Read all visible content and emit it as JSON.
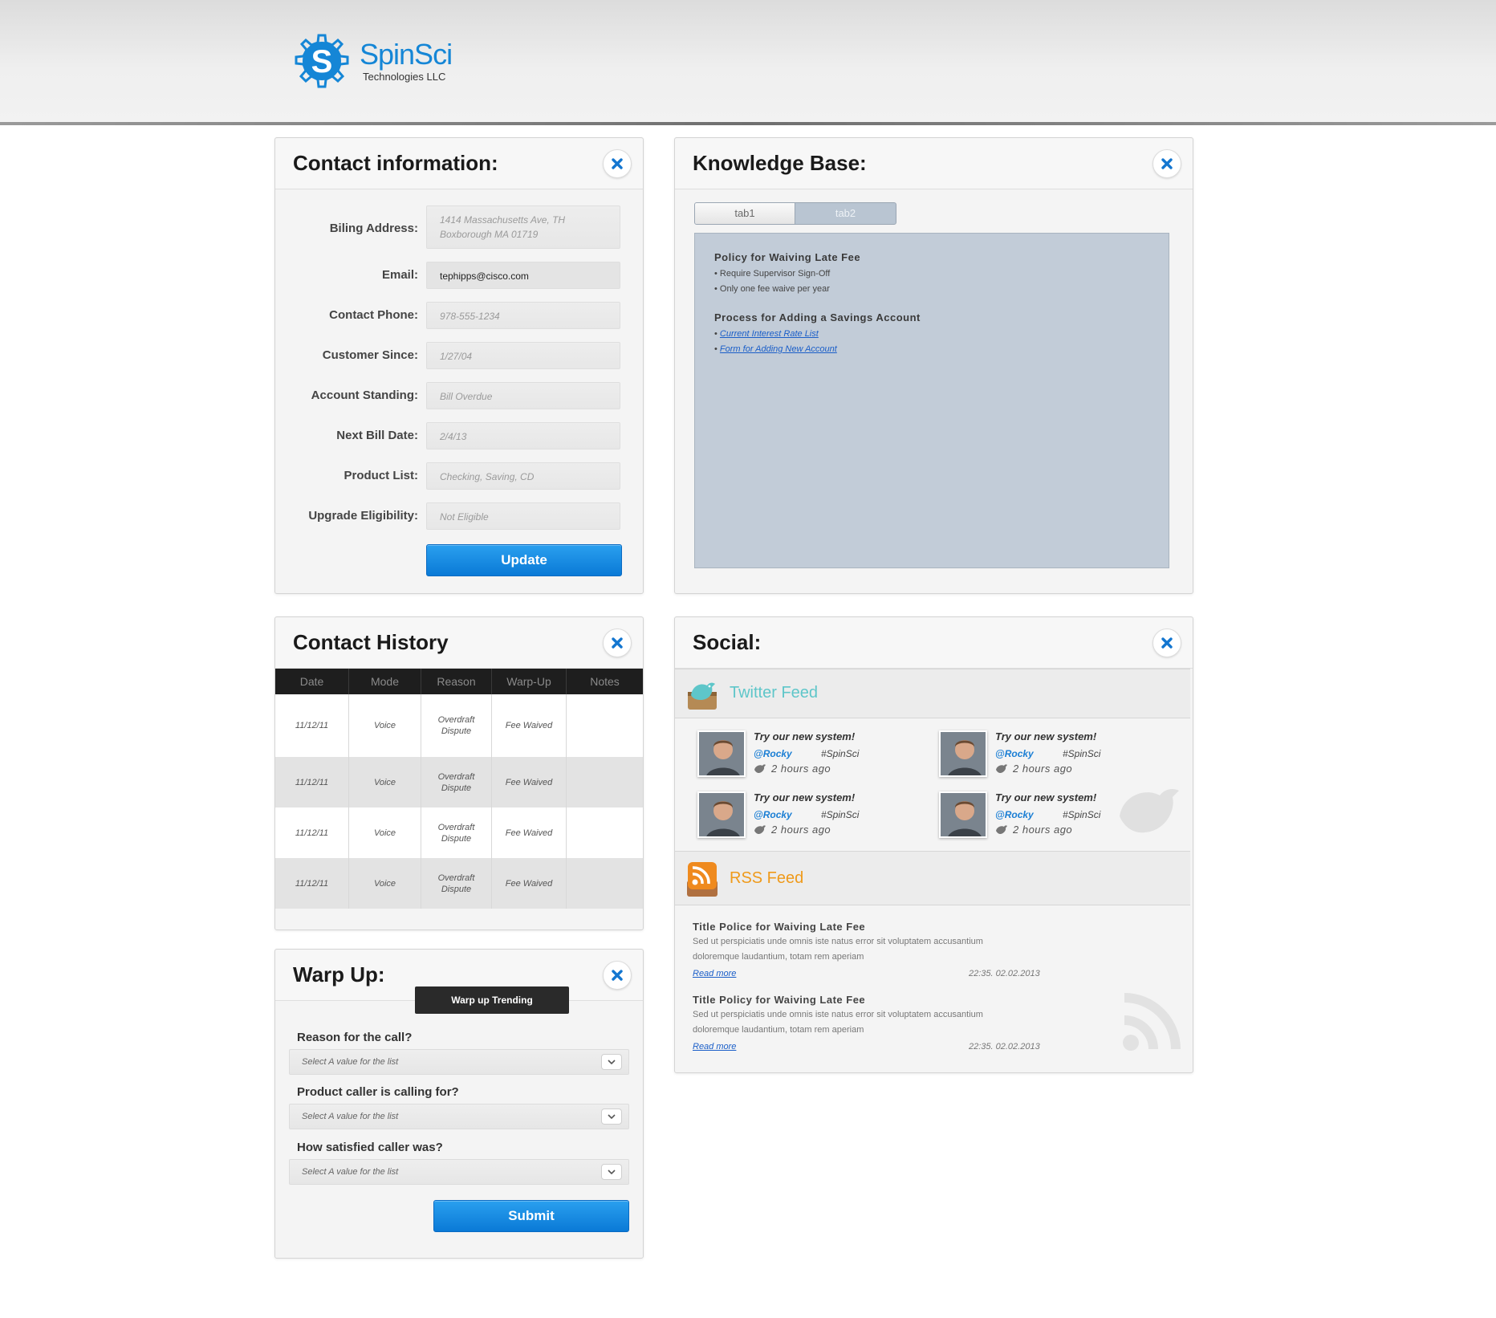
{
  "brand": {
    "name": "SpinSci",
    "subtitle": "Technologies LLC",
    "logo_letter": "S",
    "color": "#1586d6"
  },
  "contact": {
    "title": "Contact information:",
    "fields": [
      {
        "label": "Biling Address:",
        "value_line1": "1414 Massachusetts Ave, TH",
        "value_line2": "Boxborough MA 01719"
      },
      {
        "label": "Email:",
        "value": "tephipps@cisco.com"
      },
      {
        "label": "Contact Phone:",
        "value": "978-555-1234"
      },
      {
        "label": "Customer Since:",
        "value": "1/27/04"
      },
      {
        "label": "Account Standing:",
        "value": "Bill Overdue"
      },
      {
        "label": "Next Bill Date:",
        "value": "2/4/13"
      },
      {
        "label": "Product List:",
        "value": "Checking, Saving, CD"
      },
      {
        "label": "Upgrade Eligibility:",
        "value": "Not Eligible"
      }
    ],
    "update_label": "Update"
  },
  "kb": {
    "title": "Knowledge Base:",
    "tabs": [
      "tab1",
      "tab2"
    ],
    "sections": [
      {
        "heading": "Policy for Waiving Late Fee",
        "items": [
          "Require Supervisor Sign-Off",
          "Only one fee waive per year"
        ]
      },
      {
        "heading": "Process for Adding a Savings Account",
        "links": [
          "Current Interest Rate List",
          "Form for Adding New Account"
        ]
      }
    ]
  },
  "history": {
    "title": "Contact History",
    "columns": [
      "Date",
      "Mode",
      "Reason",
      "Warp-Up",
      "Notes"
    ],
    "rows": [
      {
        "date": "11/12/11",
        "mode": "Voice",
        "reason_1": "Overdraft",
        "reason_2": "Dispute",
        "warpup": "Fee Waived",
        "notes": ""
      },
      {
        "date": "11/12/11",
        "mode": "Voice",
        "reason_1": "Overdraft",
        "reason_2": "Dispute",
        "warpup": "Fee Waived",
        "notes": ""
      },
      {
        "date": "11/12/11",
        "mode": "Voice",
        "reason_1": "Overdraft",
        "reason_2": "Dispute",
        "warpup": "Fee Waived",
        "notes": ""
      },
      {
        "date": "11/12/11",
        "mode": "Voice",
        "reason_1": "Overdraft",
        "reason_2": "Dispute",
        "warpup": "Fee Waived",
        "notes": ""
      }
    ]
  },
  "warpup": {
    "title": "Warp Up:",
    "tooltip": "Warp up Trending",
    "questions": [
      {
        "label": "Reason for the call?",
        "placeholder": "Select A value for the list"
      },
      {
        "label": "Product caller is calling for?",
        "placeholder": "Select A value for the list"
      },
      {
        "label": "How satisfied caller was?",
        "placeholder": "Select A value for the list"
      }
    ],
    "submit_label": "Submit"
  },
  "social": {
    "title": "Social:",
    "twitter": {
      "title": "Twitter Feed",
      "color": "#5ec6c9",
      "tweets": [
        {
          "text": "Try our new system!",
          "user": "@Rocky",
          "tag": "#SpinSci",
          "time": "2 hours ago"
        },
        {
          "text": "Try our new system!",
          "user": "@Rocky",
          "tag": "#SpinSci",
          "time": "2 hours ago"
        },
        {
          "text": "Try our new system!",
          "user": "@Rocky",
          "tag": "#SpinSci",
          "time": "2 hours ago"
        },
        {
          "text": "Try our new system!",
          "user": "@Rocky",
          "tag": "#SpinSci",
          "time": "2 hours ago"
        }
      ]
    },
    "rss": {
      "title": "RSS Feed",
      "color": "#ef9a1a",
      "items": [
        {
          "title": "Title Police for Waiving Late Fee",
          "body_1": "Sed ut perspiciatis unde omnis iste natus error sit voluptatem accusantium",
          "body_2": "doloremque laudantium, totam rem aperiam",
          "more": "Read more",
          "date": "22:35.  02.02.2013"
        },
        {
          "title": "Title Policy for Waiving Late Fee",
          "body_1": "Sed ut perspiciatis unde omnis iste natus error sit voluptatem accusantium",
          "body_2": "doloremque laudantium, totam rem aperiam",
          "more": "Read more",
          "date": "22:35.  02.02.2013"
        }
      ]
    }
  }
}
